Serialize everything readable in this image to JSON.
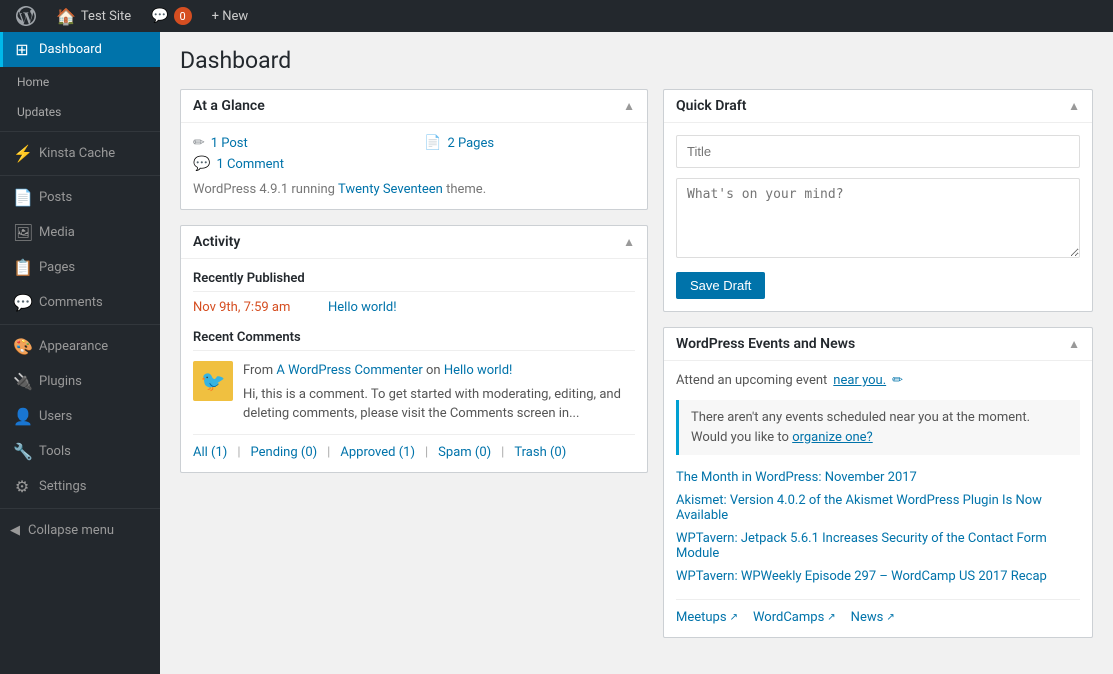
{
  "adminbar": {
    "wp_logo_title": "WordPress",
    "site_name": "Test Site",
    "comment_count": "0",
    "new_label": "+ New"
  },
  "sidebar": {
    "dashboard_label": "Dashboard",
    "home_label": "Home",
    "updates_label": "Updates",
    "kinsta_cache_label": "Kinsta Cache",
    "posts_label": "Posts",
    "media_label": "Media",
    "pages_label": "Pages",
    "comments_label": "Comments",
    "appearance_label": "Appearance",
    "plugins_label": "Plugins",
    "users_label": "Users",
    "tools_label": "Tools",
    "settings_label": "Settings",
    "collapse_label": "Collapse menu"
  },
  "page": {
    "title": "Dashboard"
  },
  "at_a_glance": {
    "title": "At a Glance",
    "posts_count": "1 Post",
    "pages_count": "2 Pages",
    "comments_count": "1 Comment",
    "wp_version_text": "WordPress 4.9.1 running",
    "theme_link_text": "Twenty Seventeen",
    "theme_suffix": "theme."
  },
  "activity": {
    "title": "Activity",
    "recently_published_label": "Recently Published",
    "published_date": "Nov 9th, 7:59 am",
    "published_post_link": "Hello world!",
    "recent_comments_label": "Recent Comments",
    "comment_from_label": "From",
    "comment_author_link": "A WordPress Commenter",
    "comment_on_text": "on",
    "comment_post_link": "Hello world!",
    "comment_text": "Hi, this is a comment. To get started with moderating, editing, and deleting comments, please visit the Comments screen in...",
    "footer_all": "All (1)",
    "footer_pending": "Pending (0)",
    "footer_approved": "Approved (1)",
    "footer_spam": "Spam (0)",
    "footer_trash": "Trash (0)"
  },
  "quick_draft": {
    "title": "Quick Draft",
    "title_placeholder": "Title",
    "content_placeholder": "What's on your mind?",
    "save_button_label": "Save Draft"
  },
  "events_news": {
    "title": "WordPress Events and News",
    "attend_text": "Attend an upcoming event",
    "near_you_text": "near you.",
    "no_events_text": "There aren't any events scheduled near you at the moment. Would you like to",
    "organize_link": "organize one?",
    "news_items": [
      {
        "text": "The Month in WordPress: November 2017"
      },
      {
        "text": "Akismet: Version 4.0.2 of the Akismet WordPress Plugin Is Now Available"
      },
      {
        "text": "WPTavern: Jetpack 5.6.1 Increases Security of the Contact Form Module"
      },
      {
        "text": "WPTavern: WPWeekly Episode 297 – WordCamp US 2017 Recap"
      }
    ],
    "meetups_label": "Meetups",
    "wordcamps_label": "WordCamps",
    "news_label": "News"
  }
}
